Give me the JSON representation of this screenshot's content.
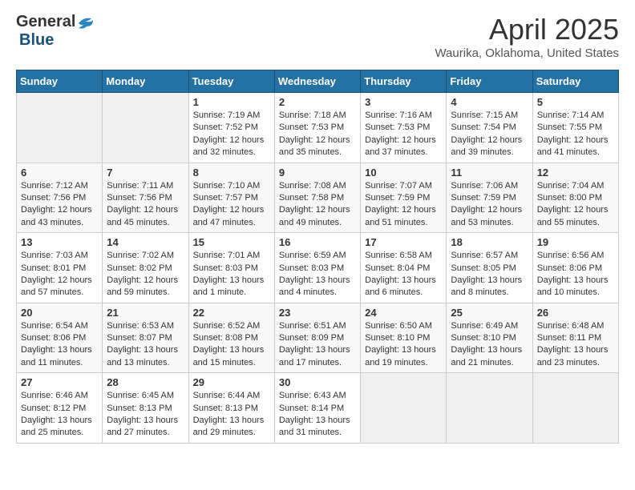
{
  "header": {
    "logo_general": "General",
    "logo_blue": "Blue",
    "month_title": "April 2025",
    "location": "Waurika, Oklahoma, United States"
  },
  "days_of_week": [
    "Sunday",
    "Monday",
    "Tuesday",
    "Wednesday",
    "Thursday",
    "Friday",
    "Saturday"
  ],
  "weeks": [
    [
      {
        "day": "",
        "empty": true
      },
      {
        "day": "",
        "empty": true
      },
      {
        "day": "1",
        "sunrise": "Sunrise: 7:19 AM",
        "sunset": "Sunset: 7:52 PM",
        "daylight": "Daylight: 12 hours and 32 minutes."
      },
      {
        "day": "2",
        "sunrise": "Sunrise: 7:18 AM",
        "sunset": "Sunset: 7:53 PM",
        "daylight": "Daylight: 12 hours and 35 minutes."
      },
      {
        "day": "3",
        "sunrise": "Sunrise: 7:16 AM",
        "sunset": "Sunset: 7:53 PM",
        "daylight": "Daylight: 12 hours and 37 minutes."
      },
      {
        "day": "4",
        "sunrise": "Sunrise: 7:15 AM",
        "sunset": "Sunset: 7:54 PM",
        "daylight": "Daylight: 12 hours and 39 minutes."
      },
      {
        "day": "5",
        "sunrise": "Sunrise: 7:14 AM",
        "sunset": "Sunset: 7:55 PM",
        "daylight": "Daylight: 12 hours and 41 minutes."
      }
    ],
    [
      {
        "day": "6",
        "sunrise": "Sunrise: 7:12 AM",
        "sunset": "Sunset: 7:56 PM",
        "daylight": "Daylight: 12 hours and 43 minutes."
      },
      {
        "day": "7",
        "sunrise": "Sunrise: 7:11 AM",
        "sunset": "Sunset: 7:56 PM",
        "daylight": "Daylight: 12 hours and 45 minutes."
      },
      {
        "day": "8",
        "sunrise": "Sunrise: 7:10 AM",
        "sunset": "Sunset: 7:57 PM",
        "daylight": "Daylight: 12 hours and 47 minutes."
      },
      {
        "day": "9",
        "sunrise": "Sunrise: 7:08 AM",
        "sunset": "Sunset: 7:58 PM",
        "daylight": "Daylight: 12 hours and 49 minutes."
      },
      {
        "day": "10",
        "sunrise": "Sunrise: 7:07 AM",
        "sunset": "Sunset: 7:59 PM",
        "daylight": "Daylight: 12 hours and 51 minutes."
      },
      {
        "day": "11",
        "sunrise": "Sunrise: 7:06 AM",
        "sunset": "Sunset: 7:59 PM",
        "daylight": "Daylight: 12 hours and 53 minutes."
      },
      {
        "day": "12",
        "sunrise": "Sunrise: 7:04 AM",
        "sunset": "Sunset: 8:00 PM",
        "daylight": "Daylight: 12 hours and 55 minutes."
      }
    ],
    [
      {
        "day": "13",
        "sunrise": "Sunrise: 7:03 AM",
        "sunset": "Sunset: 8:01 PM",
        "daylight": "Daylight: 12 hours and 57 minutes."
      },
      {
        "day": "14",
        "sunrise": "Sunrise: 7:02 AM",
        "sunset": "Sunset: 8:02 PM",
        "daylight": "Daylight: 12 hours and 59 minutes."
      },
      {
        "day": "15",
        "sunrise": "Sunrise: 7:01 AM",
        "sunset": "Sunset: 8:03 PM",
        "daylight": "Daylight: 13 hours and 1 minute."
      },
      {
        "day": "16",
        "sunrise": "Sunrise: 6:59 AM",
        "sunset": "Sunset: 8:03 PM",
        "daylight": "Daylight: 13 hours and 4 minutes."
      },
      {
        "day": "17",
        "sunrise": "Sunrise: 6:58 AM",
        "sunset": "Sunset: 8:04 PM",
        "daylight": "Daylight: 13 hours and 6 minutes."
      },
      {
        "day": "18",
        "sunrise": "Sunrise: 6:57 AM",
        "sunset": "Sunset: 8:05 PM",
        "daylight": "Daylight: 13 hours and 8 minutes."
      },
      {
        "day": "19",
        "sunrise": "Sunrise: 6:56 AM",
        "sunset": "Sunset: 8:06 PM",
        "daylight": "Daylight: 13 hours and 10 minutes."
      }
    ],
    [
      {
        "day": "20",
        "sunrise": "Sunrise: 6:54 AM",
        "sunset": "Sunset: 8:06 PM",
        "daylight": "Daylight: 13 hours and 11 minutes."
      },
      {
        "day": "21",
        "sunrise": "Sunrise: 6:53 AM",
        "sunset": "Sunset: 8:07 PM",
        "daylight": "Daylight: 13 hours and 13 minutes."
      },
      {
        "day": "22",
        "sunrise": "Sunrise: 6:52 AM",
        "sunset": "Sunset: 8:08 PM",
        "daylight": "Daylight: 13 hours and 15 minutes."
      },
      {
        "day": "23",
        "sunrise": "Sunrise: 6:51 AM",
        "sunset": "Sunset: 8:09 PM",
        "daylight": "Daylight: 13 hours and 17 minutes."
      },
      {
        "day": "24",
        "sunrise": "Sunrise: 6:50 AM",
        "sunset": "Sunset: 8:10 PM",
        "daylight": "Daylight: 13 hours and 19 minutes."
      },
      {
        "day": "25",
        "sunrise": "Sunrise: 6:49 AM",
        "sunset": "Sunset: 8:10 PM",
        "daylight": "Daylight: 13 hours and 21 minutes."
      },
      {
        "day": "26",
        "sunrise": "Sunrise: 6:48 AM",
        "sunset": "Sunset: 8:11 PM",
        "daylight": "Daylight: 13 hours and 23 minutes."
      }
    ],
    [
      {
        "day": "27",
        "sunrise": "Sunrise: 6:46 AM",
        "sunset": "Sunset: 8:12 PM",
        "daylight": "Daylight: 13 hours and 25 minutes."
      },
      {
        "day": "28",
        "sunrise": "Sunrise: 6:45 AM",
        "sunset": "Sunset: 8:13 PM",
        "daylight": "Daylight: 13 hours and 27 minutes."
      },
      {
        "day": "29",
        "sunrise": "Sunrise: 6:44 AM",
        "sunset": "Sunset: 8:13 PM",
        "daylight": "Daylight: 13 hours and 29 minutes."
      },
      {
        "day": "30",
        "sunrise": "Sunrise: 6:43 AM",
        "sunset": "Sunset: 8:14 PM",
        "daylight": "Daylight: 13 hours and 31 minutes."
      },
      {
        "day": "",
        "empty": true
      },
      {
        "day": "",
        "empty": true
      },
      {
        "day": "",
        "empty": true
      }
    ]
  ]
}
